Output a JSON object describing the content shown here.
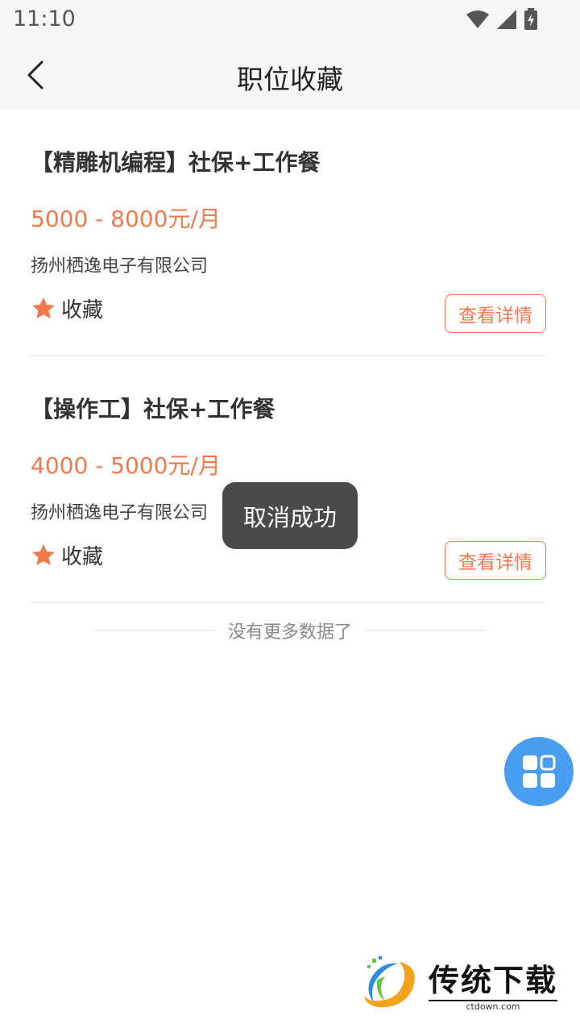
{
  "status_bar": {
    "time": "11:10"
  },
  "header": {
    "title": "职位收藏"
  },
  "jobs": [
    {
      "title": "【精雕机编程】社保+工作餐",
      "salary": "5000 - 8000元/月",
      "company": "扬州栖逸电子有限公司",
      "favorite_label": "收藏",
      "detail_label": "查看详情"
    },
    {
      "title": "【操作工】社保+工作餐",
      "salary": "4000 - 5000元/月",
      "company": "扬州栖逸电子有限公司",
      "favorite_label": "收藏",
      "detail_label": "查看详情"
    }
  ],
  "list_footer": "没有更多数据了",
  "toast": "取消成功",
  "watermark": {
    "text": "传统下载",
    "sub": "ctdown.com"
  },
  "colors": {
    "accent": "#f07a4d",
    "fab": "#4a9ef2",
    "toast_bg": "#4a4a4a"
  },
  "icons": {
    "back": "chevron-left-icon",
    "favorite": "star-icon",
    "fab": "grid-icon"
  }
}
